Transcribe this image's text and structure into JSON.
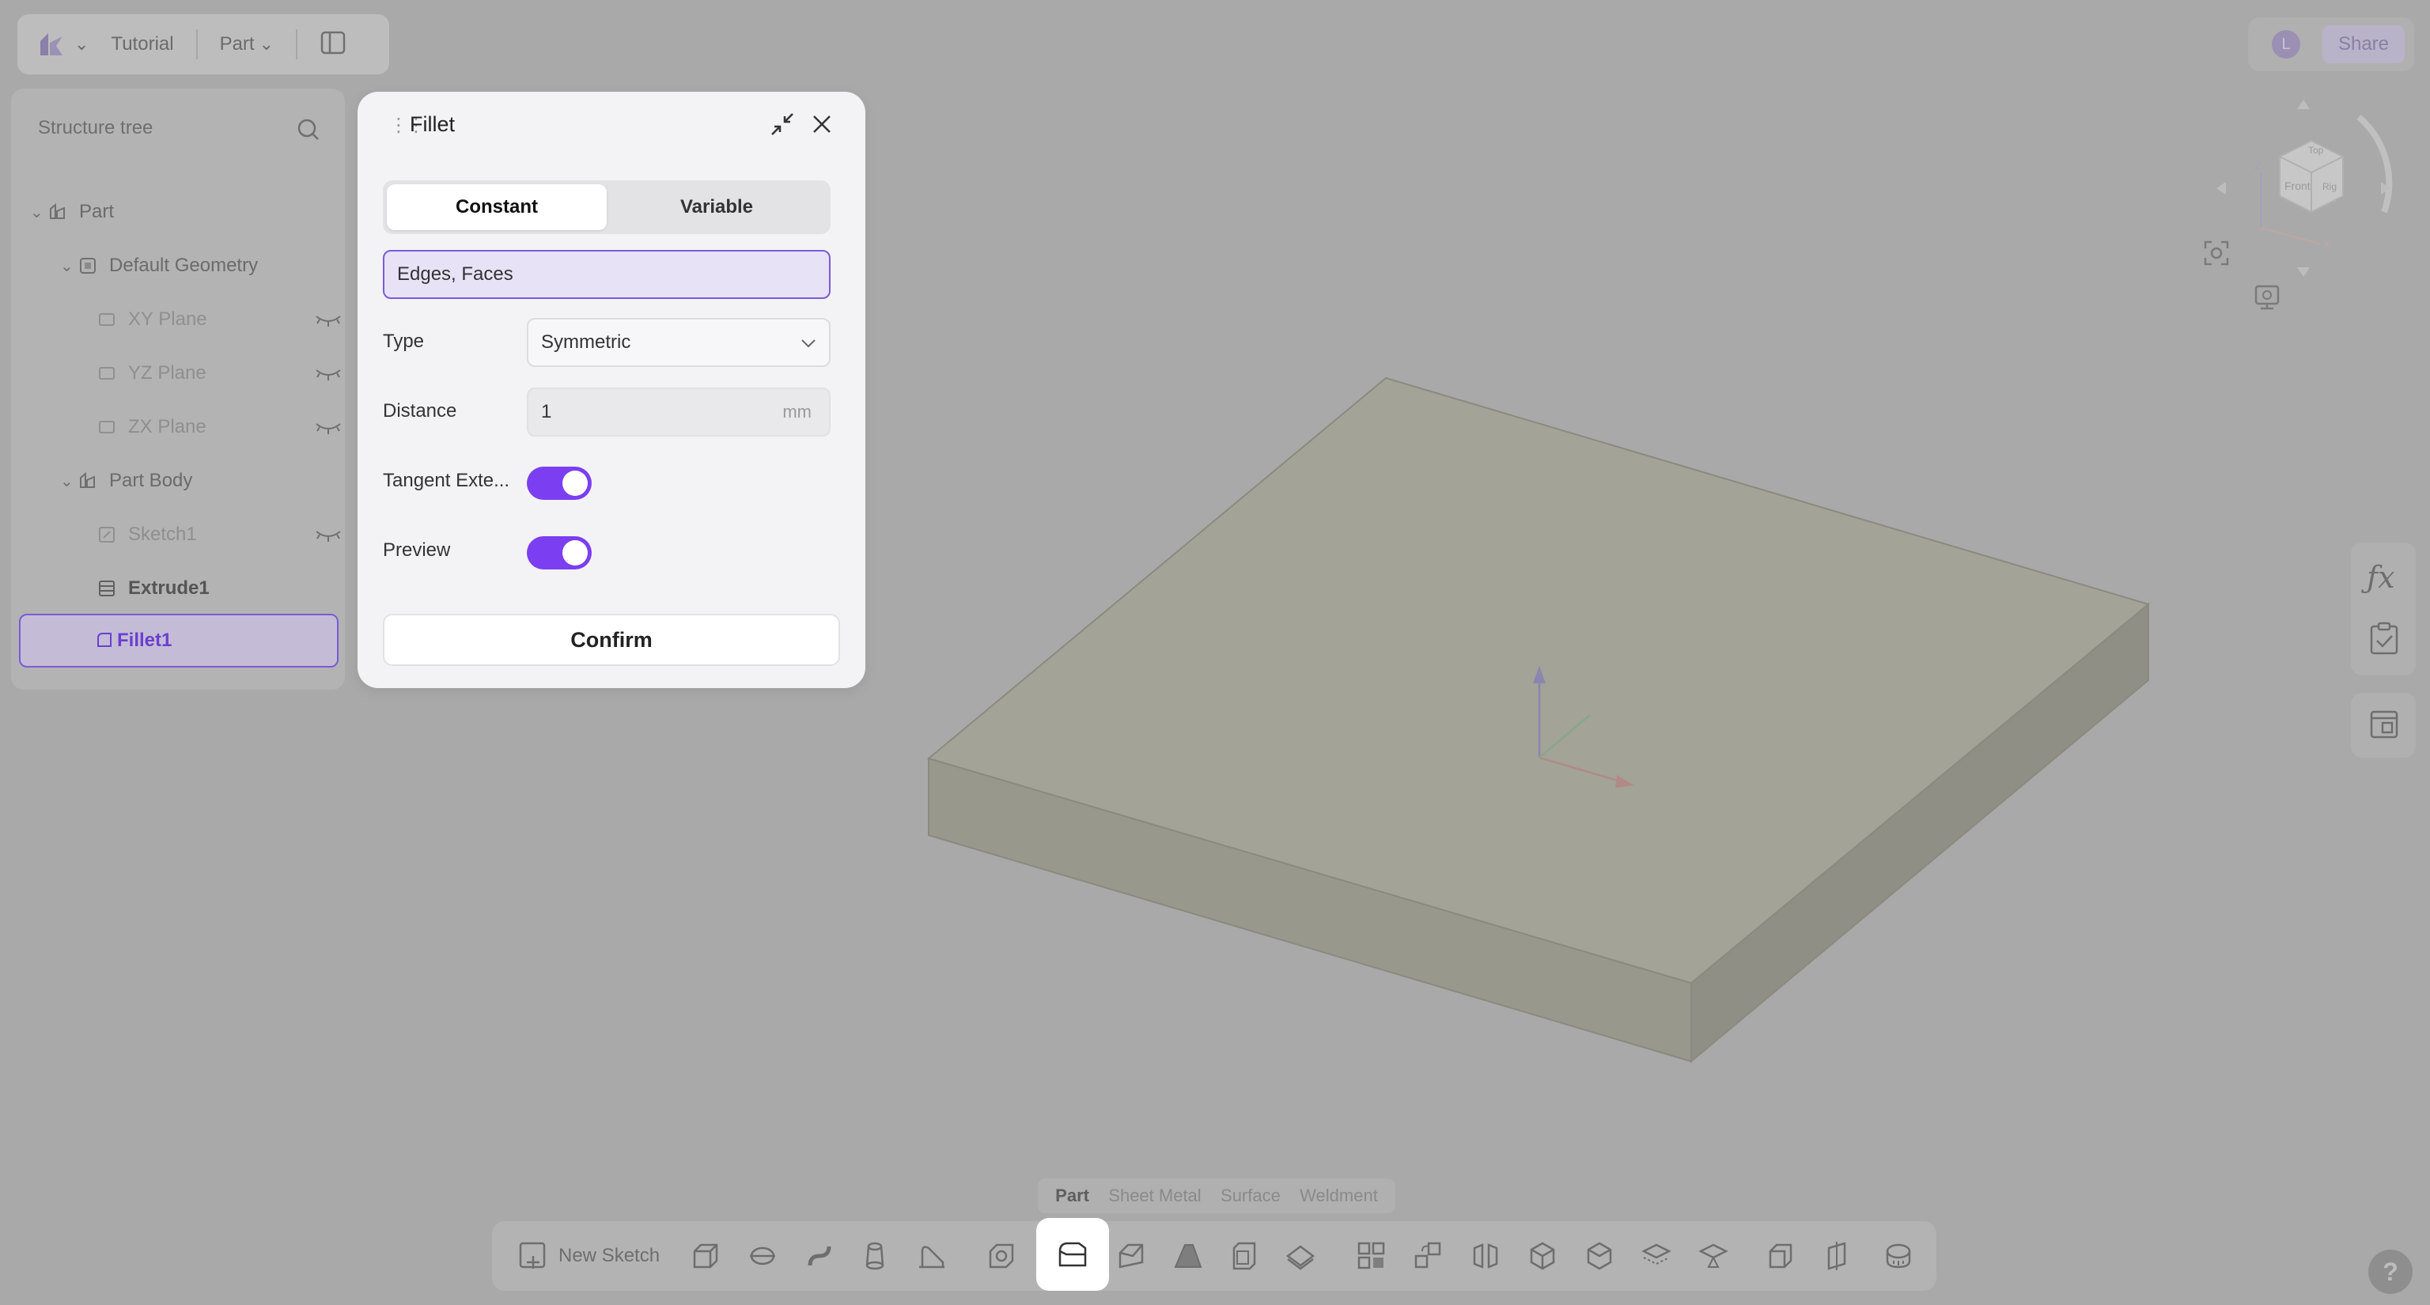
{
  "header": {
    "breadcrumb_1": "Tutorial",
    "breadcrumb_2": "Part",
    "avatar_letter": "L",
    "share_label": "Share"
  },
  "tree": {
    "title": "Structure tree",
    "items": [
      {
        "label": "Part"
      },
      {
        "label": "Default Geometry"
      },
      {
        "label": "XY Plane"
      },
      {
        "label": "YZ Plane"
      },
      {
        "label": "ZX Plane"
      },
      {
        "label": "Part Body"
      },
      {
        "label": "Sketch1"
      },
      {
        "label": "Extrude1"
      },
      {
        "label": "Fillet1"
      }
    ]
  },
  "dialog": {
    "title": "Fillet",
    "tab_constant": "Constant",
    "tab_variable": "Variable",
    "selection_value": "Edges, Faces",
    "type_label": "Type",
    "type_value": "Symmetric",
    "distance_label": "Distance",
    "distance_value": "1",
    "distance_unit": "mm",
    "tangent_label": "Tangent Exte...",
    "preview_label": "Preview",
    "confirm_label": "Confirm",
    "tangent_on": true,
    "preview_on": true
  },
  "viewcube": {
    "top": "Top",
    "front": "Front",
    "right": "Rig"
  },
  "modes": {
    "part": "Part",
    "sheet_metal": "Sheet Metal",
    "surface": "Surface",
    "weldment": "Weldment"
  },
  "toolbar": {
    "new_sketch": "New Sketch"
  },
  "help_label": "?",
  "colors": {
    "accent": "#7b3ef0",
    "selection": "#7b5bd6",
    "model_top": "#a3a397",
    "model_front": "#98988d",
    "model_side": "#8f8f85"
  }
}
